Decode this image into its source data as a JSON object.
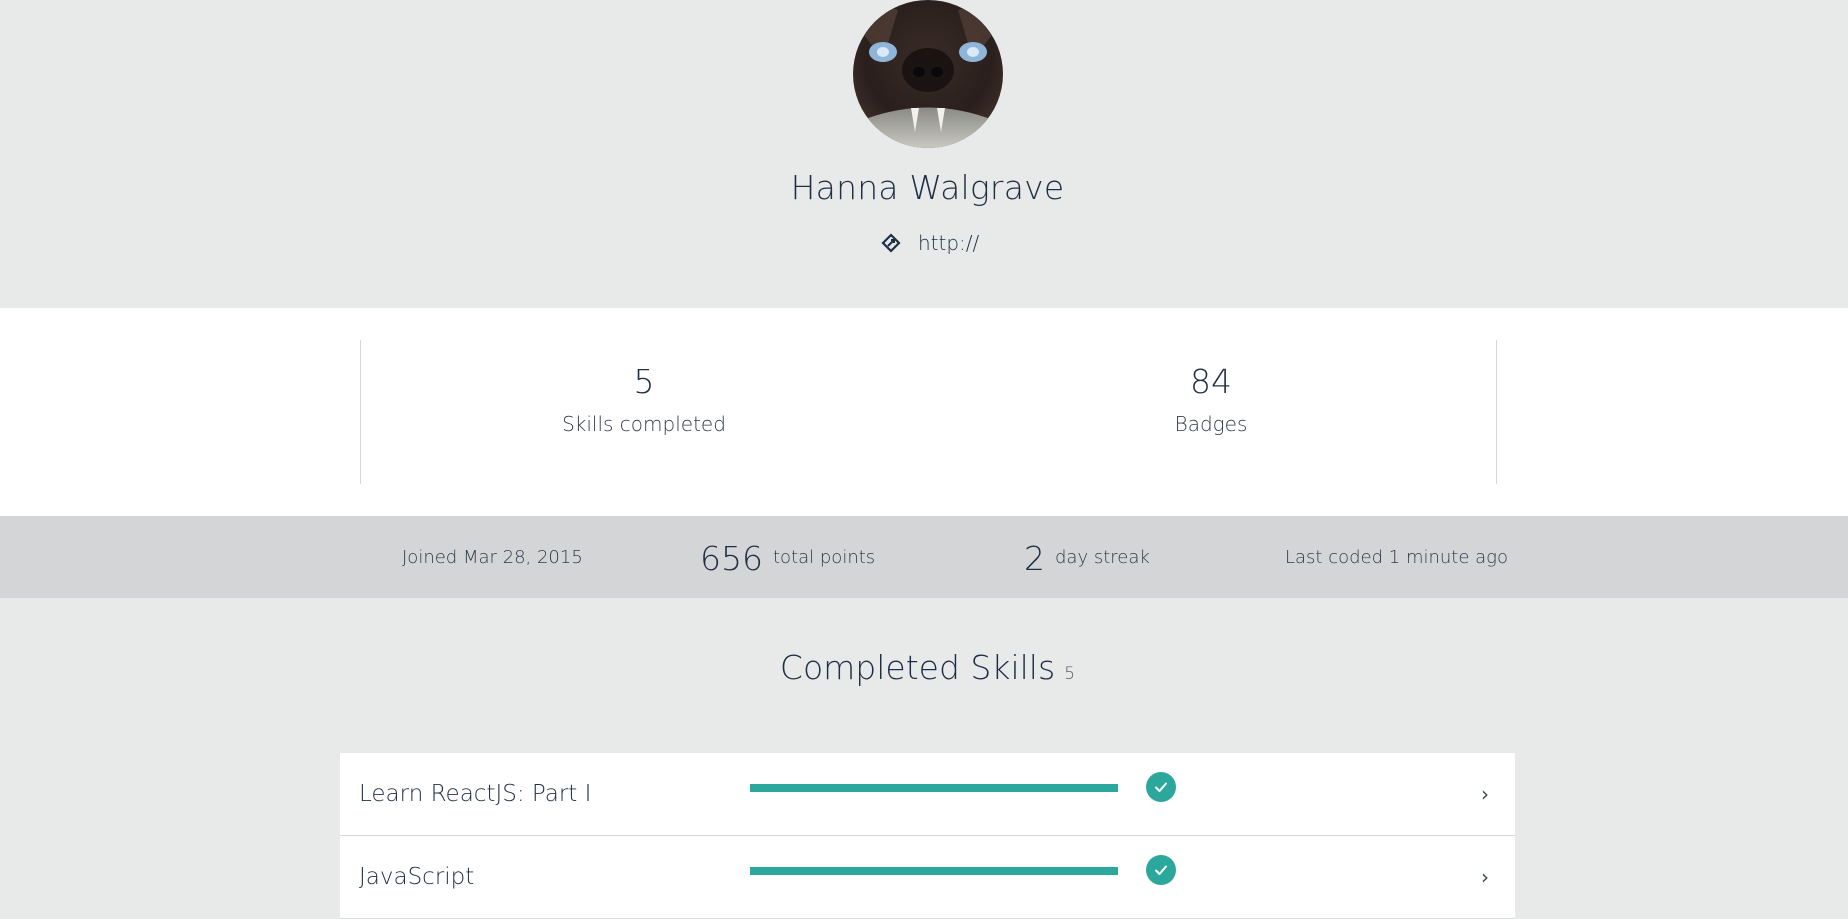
{
  "profile": {
    "name": "Hanna Walgrave",
    "website": "http://",
    "avatar_icon": "user-avatar-photo",
    "link_icon": "link-icon"
  },
  "stats": {
    "skills_completed_value": "5",
    "skills_completed_label": "Skills completed",
    "badges_value": "84",
    "badges_label": "Badges"
  },
  "meta": {
    "joined": "Joined Mar 28, 2015",
    "total_points_value": "656",
    "total_points_label": "total points",
    "streak_value": "2",
    "streak_label": "day streak",
    "last_coded": "Last coded 1 minute ago"
  },
  "completed_skills": {
    "title": "Completed Skills",
    "count": "5",
    "items": [
      {
        "name": "Learn ReactJS: Part I",
        "progress": 1.0,
        "status_icon": "check-icon",
        "chevron": "›"
      },
      {
        "name": "JavaScript",
        "progress": 1.0,
        "status_icon": "check-icon",
        "chevron": "›"
      }
    ]
  },
  "colors": {
    "accent": "#2ba89b",
    "text_dark": "#1e2f45",
    "page_bg": "#e8eaea",
    "meta_bar_bg": "#d3d5d7"
  }
}
